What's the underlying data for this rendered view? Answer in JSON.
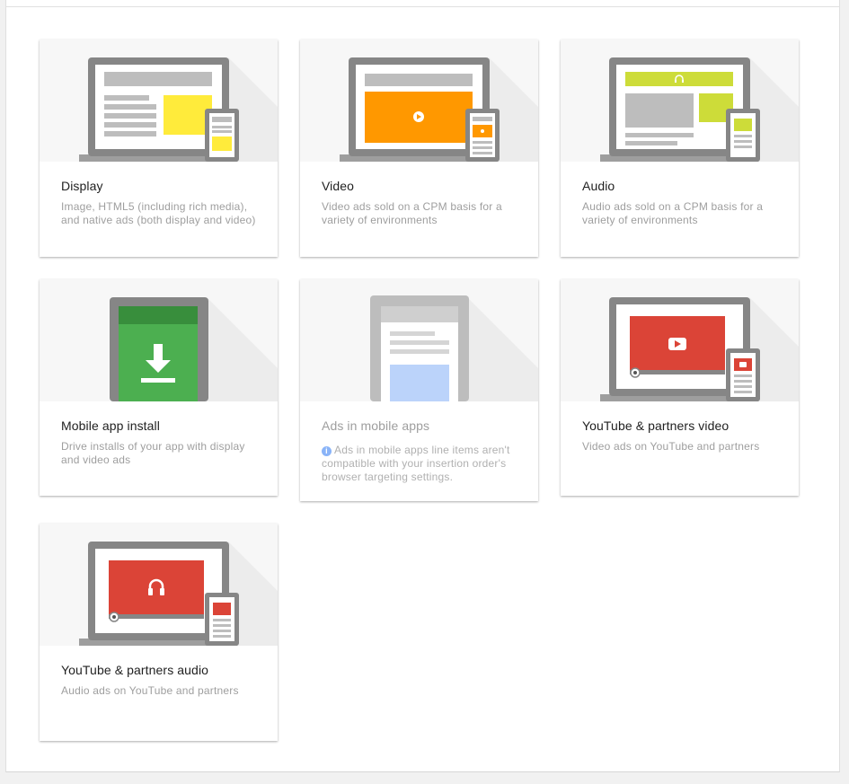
{
  "cards": [
    {
      "title": "Display",
      "description": "Image, HTML5 (including rich media), and native ads (both display and video)",
      "icon": "display-icon"
    },
    {
      "title": "Video",
      "description": "Video ads sold on a CPM basis for a variety of environments",
      "icon": "video-icon"
    },
    {
      "title": "Audio",
      "description": "Audio ads sold on a CPM basis for a variety of environments",
      "icon": "audio-icon"
    },
    {
      "title": "Mobile app install",
      "description": "Drive installs of your app with display and video ads",
      "icon": "mobile-app-install-icon"
    },
    {
      "title": "Ads in mobile apps",
      "description": "Ads in mobile apps line items aren't compatible with your insertion order's browser targeting settings.",
      "icon": "ads-in-mobile-apps-icon",
      "disabled": true,
      "info_icon": "info-icon"
    },
    {
      "title": "YouTube & partners video",
      "description": "Video ads on YouTube and partners",
      "icon": "youtube-video-icon"
    },
    {
      "title": "YouTube & partners audio",
      "description": "Audio ads on YouTube and partners",
      "icon": "youtube-audio-icon"
    }
  ],
  "colors": {
    "display_accent": "#ffeb3b",
    "video_accent": "#ff9800",
    "audio_accent": "#cddc39",
    "app_install_accent": "#4caf50",
    "app_install_dark": "#388e3c",
    "mobile_apps_accent": "#bbd3fa",
    "youtube_accent": "#db4437",
    "device_frame": "#868686"
  }
}
